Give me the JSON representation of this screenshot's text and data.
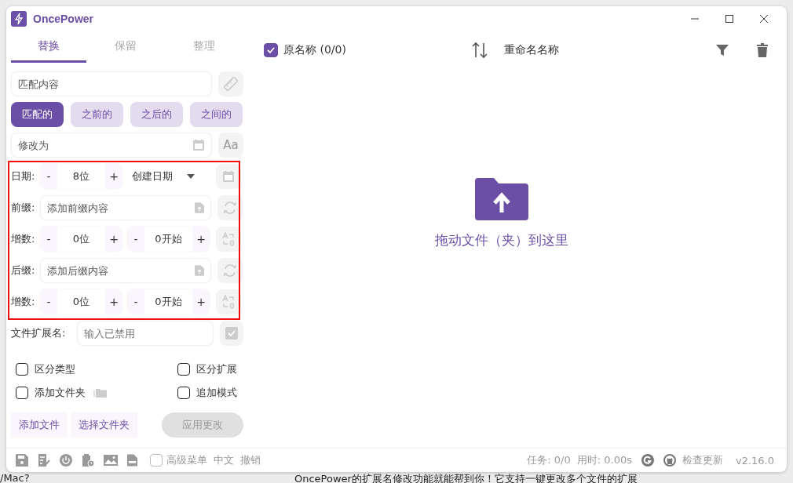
{
  "app": {
    "title": "OncePower"
  },
  "tabs": [
    {
      "label": "替换",
      "selected": true
    },
    {
      "label": "保留",
      "selected": false
    },
    {
      "label": "整理",
      "selected": false
    }
  ],
  "match_field": {
    "placeholder": "匹配内容"
  },
  "match_modes": [
    {
      "label": "匹配的",
      "selected": true
    },
    {
      "label": "之前的",
      "selected": false
    },
    {
      "label": "之后的",
      "selected": false
    },
    {
      "label": "之间的",
      "selected": false
    }
  ],
  "replace_field": {
    "placeholder": "修改为",
    "case_button": "Aa"
  },
  "rows": [
    {
      "kind": "date",
      "label": "日期:",
      "steppers": [
        {
          "minus": "-",
          "value": "8位",
          "plus": "+"
        }
      ],
      "dropdown": "创建日期"
    },
    {
      "kind": "text",
      "label": "前缀:",
      "placeholder": "添加前缀内容"
    },
    {
      "kind": "counter",
      "label": "增数:",
      "steppers": [
        {
          "minus": "-",
          "value": "0位",
          "plus": "+"
        },
        {
          "minus": "-",
          "value": "0开始",
          "plus": "+"
        }
      ]
    },
    {
      "kind": "text",
      "label": "后缀:",
      "placeholder": "添加后缀内容"
    },
    {
      "kind": "counter",
      "label": "增数:",
      "steppers": [
        {
          "minus": "-",
          "value": "0位",
          "plus": "+"
        },
        {
          "minus": "-",
          "value": "0开始",
          "plus": "+"
        }
      ]
    }
  ],
  "extension": {
    "label": "文件扩展名:",
    "placeholder": "输入已禁用",
    "disabled": true
  },
  "options": [
    {
      "label": "区分类型",
      "checked": false
    },
    {
      "label": "区分扩展",
      "checked": false
    },
    {
      "label": "添加文件夹",
      "checked": false,
      "folder_icon": true
    },
    {
      "label": "追加模式",
      "checked": false
    }
  ],
  "buttons": [
    {
      "label": "添加文件",
      "disabled": false
    },
    {
      "label": "选择文件夹",
      "disabled": false
    },
    {
      "label": "应用更改",
      "disabled": true
    }
  ],
  "list_header": {
    "original": {
      "label": "原名称 (0/0)",
      "checked": true
    },
    "renamed": "重命名名称"
  },
  "drop_zone": {
    "text": "拖动文件（夹）到这里"
  },
  "status_bar": {
    "advanced_menu": {
      "label": "高级菜单",
      "checked": false
    },
    "language": "中文",
    "undo": "撤销",
    "tasks": "任务: 0/0",
    "elapsed": "用时: 0.00s",
    "check_update": "检查更新",
    "version": "v2.16.0"
  },
  "annotation": {
    "kind": "highlight-frame"
  },
  "background": {
    "left_text": "/Mac?",
    "bottom_text": "OncePower的扩展名修改功能就能帮到你！它支持一键更改多个文件的扩展"
  }
}
